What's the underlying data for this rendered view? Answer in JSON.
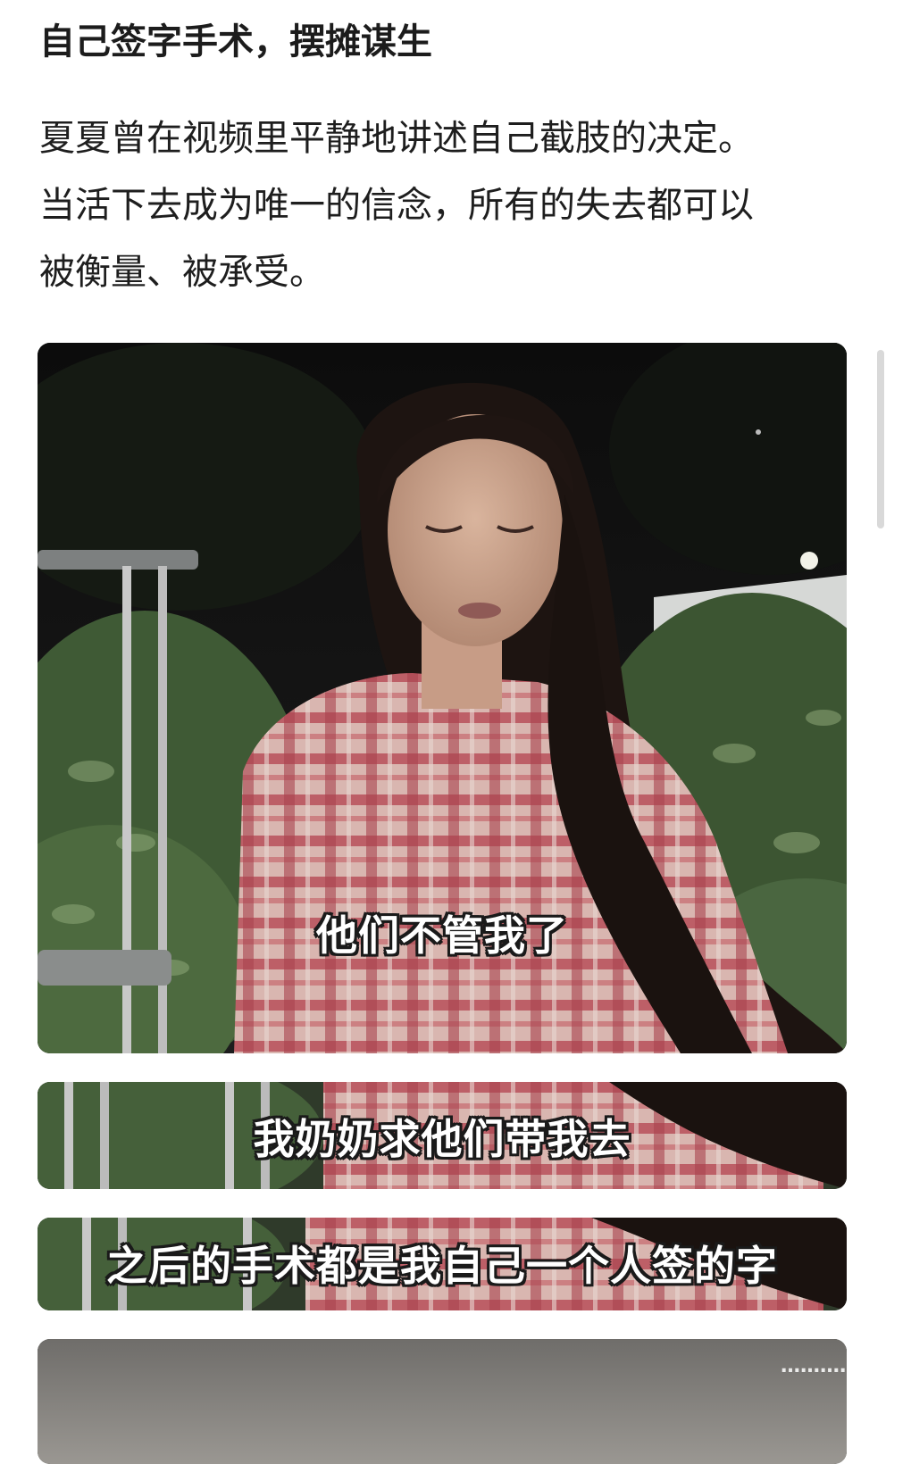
{
  "article": {
    "heading": "自己签字手术，摆摊谋生",
    "paragraph_lines": [
      "夏夏曾在视频里平静地讲述自己截肢的决定。",
      "当活下去成为唯一的信念，所有的失去都可以",
      "被衡量、被承受。"
    ]
  },
  "frames": [
    {
      "subtitle": "他们不管我了"
    },
    {
      "subtitle": "我奶奶求他们带我去"
    },
    {
      "subtitle": "之后的手术都是我自己一个人签的字"
    }
  ],
  "watermark": "…………",
  "colors": {
    "background": "#ffffff",
    "text": "#1e1e1e",
    "subtitle_fill": "#ffffff",
    "subtitle_outline": "#1a1a1a",
    "plaid_red": "#b9505a",
    "foliage": "#3f5a35"
  }
}
